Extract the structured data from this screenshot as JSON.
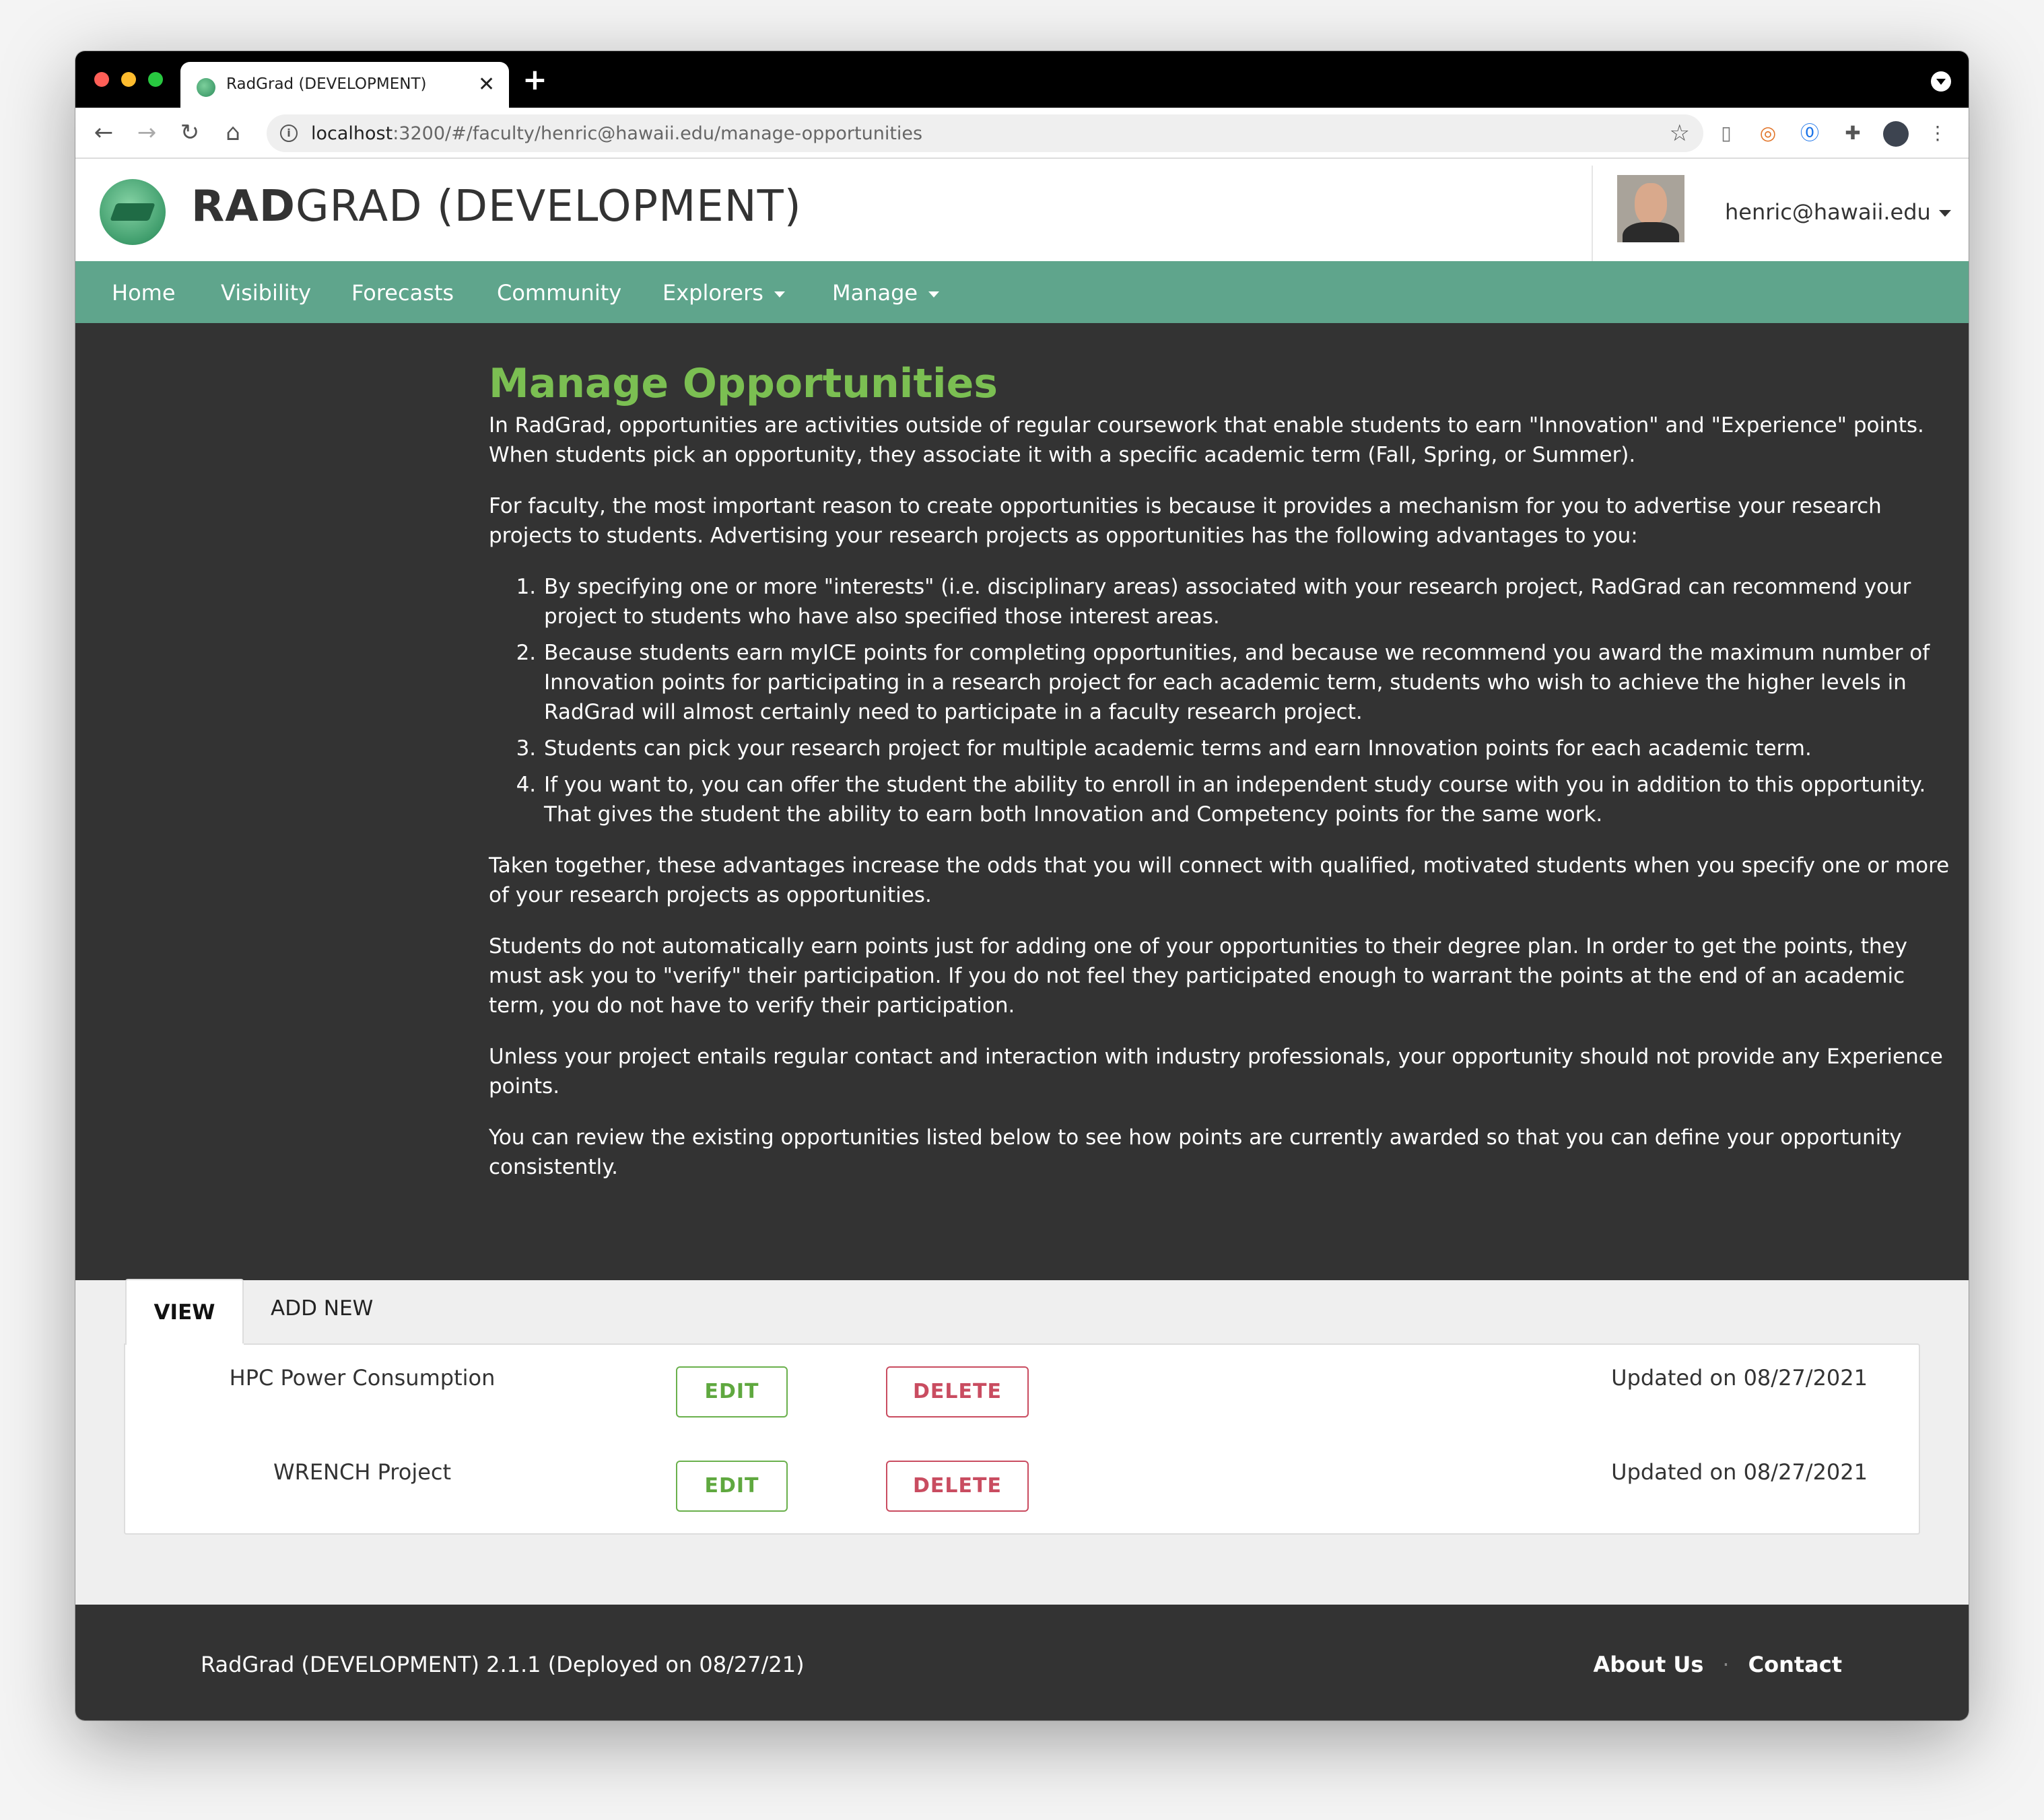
{
  "browser": {
    "tab_title": "RadGrad (DEVELOPMENT)",
    "url_host": "localhost",
    "url_path": ":3200/#/faculty/henric@hawaii.edu/manage-opportunities"
  },
  "header": {
    "title_bold": "RAD",
    "title_rest": "GRAD (DEVELOPMENT)",
    "user": "henric@hawaii.edu"
  },
  "nav": {
    "items": [
      "Home",
      "Visibility",
      "Forecasts",
      "Community",
      "Explorers",
      "Manage"
    ]
  },
  "intro": {
    "heading": "Manage Opportunities",
    "p1": "In RadGrad, opportunities are activities outside of regular coursework that enable students to earn \"Innovation\" and \"Experience\" points. When students pick an opportunity, they associate it with a specific academic term (Fall, Spring, or Summer).",
    "p2": "For faculty, the most important reason to create opportunities is because it provides a mechanism for you to advertise your research projects to students. Advertising your research projects as opportunities has the following advantages to you:",
    "list": [
      "By specifying one or more \"interests\" (i.e. disciplinary areas) associated with your research project, RadGrad can recommend your project to students who have also specified those interest areas.",
      "Because students earn myICE points for completing opportunities, and because we recommend you award the maximum number of Innovation points for participating in a research project for each academic term, students who wish to achieve the higher levels in RadGrad will almost certainly need to participate in a faculty research project.",
      "Students can pick your research project for multiple academic terms and earn Innovation points for each academic term.",
      "If you want to, you can offer the student the ability to enroll in an independent study course with you in addition to this opportunity. That gives the student the ability to earn both Innovation and Competency points for the same work."
    ],
    "p3": "Taken together, these advantages increase the odds that you will connect with qualified, motivated students when you specify one or more of your research projects as opportunities.",
    "p4": "Students do not automatically earn points just for adding one of your opportunities to their degree plan. In order to get the points, they must ask you to \"verify\" their participation. If you do not feel they participated enough to warrant the points at the end of an academic term, you do not have to verify their participation.",
    "p5": "Unless your project entails regular contact and interaction with industry professionals, your opportunity should not provide any Experience points.",
    "p6": "You can review the existing opportunities listed below to see how points are currently awarded so that you can define your opportunity consistently."
  },
  "manage": {
    "tab_view": "VIEW",
    "tab_add": "ADD NEW",
    "edit_label": "EDIT",
    "delete_label": "DELETE",
    "opportunities": [
      {
        "name": "HPC Power Consumption",
        "updated": "Updated on 08/27/2021"
      },
      {
        "name": "WRENCH Project",
        "updated": "Updated on 08/27/2021"
      }
    ]
  },
  "footer": {
    "version": "RadGrad (DEVELOPMENT) 2.1.1 (Deployed on 08/27/21)",
    "about": "About Us",
    "contact": "Contact"
  }
}
